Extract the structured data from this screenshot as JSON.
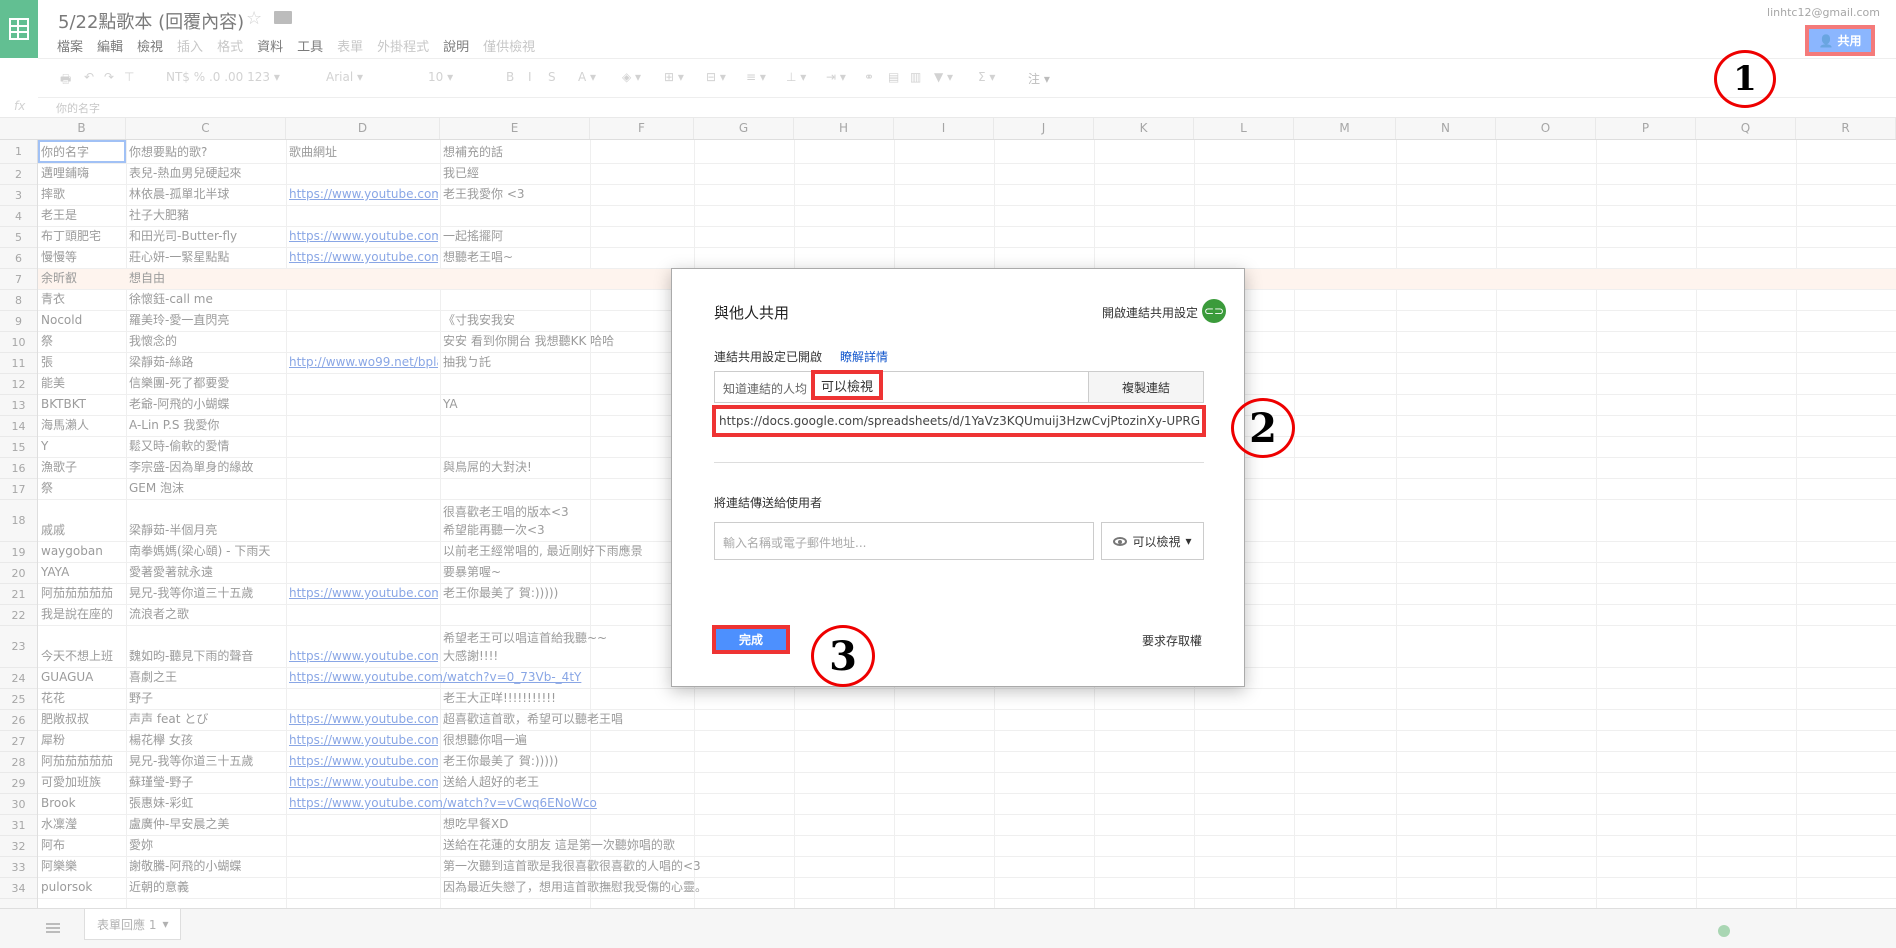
{
  "header": {
    "doc_title": "5/22點歌本 (回覆內容)",
    "menu": [
      "檔案",
      "編輯",
      "檢視",
      "插入",
      "格式",
      "資料",
      "工具",
      "表單",
      "外掛程式",
      "說明",
      "僅供檢視"
    ],
    "user_email": "linhtc12@gmail.com",
    "share_button": "共用"
  },
  "formula_bar": {
    "fx": "fx",
    "content": "你的名字"
  },
  "columns": [
    "B",
    "C",
    "D",
    "E",
    "F",
    "G",
    "H",
    "I",
    "J",
    "K",
    "L",
    "M",
    "N",
    "O",
    "P",
    "Q",
    "R"
  ],
  "rows": [
    {
      "n": "1",
      "b": "你的名字",
      "c": "你想要點的歌?",
      "d": "歌曲網址",
      "e": "想補充的話"
    },
    {
      "n": "2",
      "b": "邁哩鋪嗨",
      "c": "表兒-熱血男兒硬起來",
      "d": "",
      "e": "我已經"
    },
    {
      "n": "3",
      "b": "摔歌",
      "c": "林依晨-孤單北半球",
      "d": "https://www.youtube.com",
      "e": "老王我愛你 <3"
    },
    {
      "n": "4",
      "b": "老王是",
      "c": "社子大肥豬",
      "d": "",
      "e": ""
    },
    {
      "n": "5",
      "b": "布丁頭肥宅",
      "c": "和田光司-Butter-fly",
      "d": "https://www.youtube.com",
      "e": "一起搖擺阿"
    },
    {
      "n": "6",
      "b": "慢慢等",
      "c": "莊心妍-一緊星點點",
      "d": "https://www.youtube.com",
      "e": "想聽老王唱~"
    },
    {
      "n": "7",
      "b": "余昕叡",
      "c": "想自由",
      "d": "",
      "e": ""
    },
    {
      "n": "8",
      "b": "青衣",
      "c": "徐懷鈺-call me",
      "d": "",
      "e": ""
    },
    {
      "n": "9",
      "b": "Nocold",
      "c": "羅美玲-愛一直閃亮",
      "d": "",
      "e": "《寸我安我安"
    },
    {
      "n": "10",
      "b": "祭",
      "c": "我懷念的",
      "d": "",
      "e": "安安 看到你開台 我想聽KK 哈哈"
    },
    {
      "n": "11",
      "b": "張",
      "c": "梁靜茹-絲路",
      "d": "http://www.wo99.net/bpla",
      "e": "抽我ㄅ託"
    },
    {
      "n": "12",
      "b": "能美",
      "c": "信樂團-死了都要愛",
      "d": "",
      "e": ""
    },
    {
      "n": "13",
      "b": "BKTBKT",
      "c": "老爺-阿飛的小蝴蝶",
      "d": "",
      "e": "YA"
    },
    {
      "n": "14",
      "b": "海馬瀨人",
      "c": "A-Lin P.S 我愛你",
      "d": "",
      "e": ""
    },
    {
      "n": "15",
      "b": "Y",
      "c": "鬆又時-偷軟的愛情",
      "d": "",
      "e": ""
    },
    {
      "n": "16",
      "b": "漁歌子",
      "c": "李宗盛-因為單身的緣故",
      "d": "",
      "e": "與鳥屌的大對決!"
    },
    {
      "n": "17",
      "b": "祭",
      "c": "GEM 泡沫",
      "d": "",
      "e": ""
    },
    {
      "n": "18",
      "b": "戚戚",
      "c": "梁靜茹-半個月亮",
      "d": "",
      "e": "很喜歡老王唱的版本<3\n希望能再聽一次<3"
    },
    {
      "n": "19",
      "b": "waygoban",
      "c": "南拳媽媽(梁心頤) - 下雨天",
      "d": "",
      "e": "以前老王經常唱的, 最近剛好下雨應景"
    },
    {
      "n": "20",
      "b": "YAYA",
      "c": "愛著愛著就永遠",
      "d": "",
      "e": "要暴第喔~"
    },
    {
      "n": "21",
      "b": "阿茄茄茄茄茄",
      "c": "晃兄-我等你道三十五歲",
      "d": "https://www.youtube.com",
      "e": "老王你最美了 賀:)))))"
    },
    {
      "n": "22",
      "b": "我是說在座的",
      "c": "流浪者之歌",
      "d": "",
      "e": ""
    },
    {
      "n": "23",
      "b": "今天不想上班",
      "c": "魏如昀-聽見下雨的聲音",
      "d": "https://www.youtube.com",
      "e": "希望老王可以唱這首給我聽~~\n大感謝!!!!"
    },
    {
      "n": "24",
      "b": "GUAGUA",
      "c": "喜劇之王",
      "d": "https://www.youtube.com/watch?v=0_73Vb-_4tY",
      "e": ""
    },
    {
      "n": "25",
      "b": "花花",
      "c": "野子",
      "d": "",
      "e": "老王大正咩!!!!!!!!!!!"
    },
    {
      "n": "26",
      "b": "肥敞叔叔",
      "c": "声声 feat とび",
      "d": "https://www.youtube.com",
      "e": "超喜歡這首歌，希望可以聽老王唱"
    },
    {
      "n": "27",
      "b": "犀粉",
      "c": "楊花欅 女孩",
      "d": "https://www.youtube.com",
      "e": "很想聽你唱一遍"
    },
    {
      "n": "28",
      "b": "阿茄茄茄茄茄",
      "c": "晃兄-我等你道三十五歲",
      "d": "https://www.youtube.com",
      "e": "老王你最美了 賀:)))))"
    },
    {
      "n": "29",
      "b": "可愛加班族",
      "c": "蘇瑾瑩-野子",
      "d": "https://www.youtube.com",
      "e": "送給人超好的老王"
    },
    {
      "n": "30",
      "b": "Brook",
      "c": "張惠妹-彩虹",
      "d": "https://www.youtube.com/watch?v=vCwq6ENoWco",
      "e": ""
    },
    {
      "n": "31",
      "b": "水凜瀅",
      "c": "盧廣仲-早安晨之美",
      "d": "",
      "e": "想吃早餐XD"
    },
    {
      "n": "32",
      "b": "阿布",
      "c": "愛妳",
      "d": "",
      "e": "送給在花蓮的女朋友 這是第一次聽妳唱的歌"
    },
    {
      "n": "33",
      "b": "阿樂樂",
      "c": "謝敬騰-阿飛的小蝴蝶",
      "d": "",
      "e": "第一次聽到這首歌是我很喜歡很喜歡的人唱的<3"
    },
    {
      "n": "34",
      "b": "pulorsok",
      "c": "近朝的意義",
      "d": "",
      "e": "因為最近失戀了，想用這首歌撫慰我受傷的心靈。"
    }
  ],
  "bottom": {
    "sheet_tab": "表單回應 1"
  },
  "dialog": {
    "title": "與他人共用",
    "link_settings": "開啟連結共用設定",
    "link_status": "連結共用設定已開啟",
    "learn_more": "瞭解詳情",
    "access_prefix": "知道連結的人均",
    "access_level": "可以檢視",
    "copy_link": "複製連結",
    "share_url": "https://docs.google.com/spreadsheets/d/1YaVz3KQUmuij3HzwCvjPtozinXy-UPRG",
    "send_label": "將連結傳送給使用者",
    "invite_placeholder": "輸入名稱或電子郵件地址...",
    "invite_permission": "可以檢視",
    "done": "完成",
    "request_access": "要求存取權"
  },
  "annotations": [
    "1",
    "2",
    "3"
  ],
  "colors": {
    "accent_blue": "#4d90fe",
    "highlight_red": "#ee3333",
    "sheets_green": "#0f9d58"
  }
}
